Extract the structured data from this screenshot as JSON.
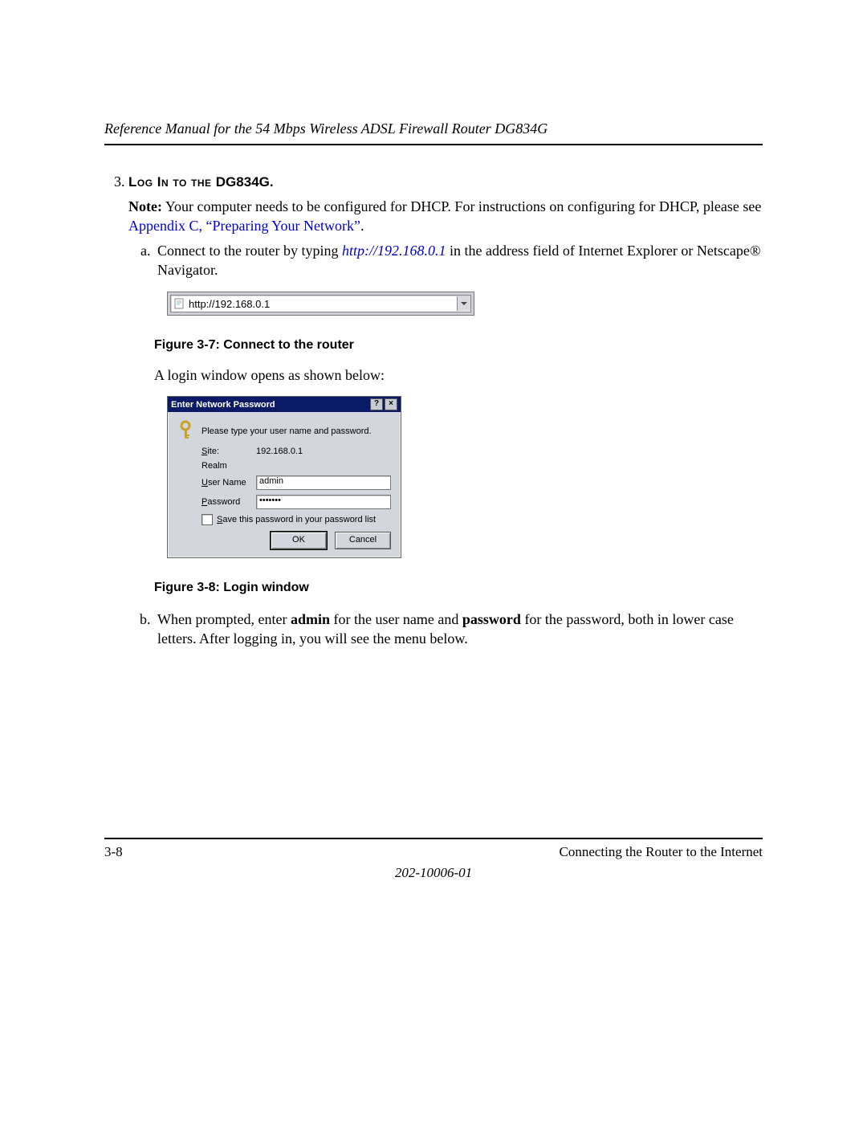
{
  "header": {
    "running_title": "Reference Manual for the 54 Mbps Wireless ADSL Firewall Router DG834G"
  },
  "step": {
    "number": "3.",
    "title_caps": "Log In to the ",
    "title_model": "DG834G",
    "title_period": ".",
    "note_label": "Note:",
    "note_text": " Your computer needs to be configured for DHCP. For instructions on configuring for DHCP, please see ",
    "note_link": "Appendix C, “Preparing Your Network”",
    "note_after": ".",
    "sub_a_pre": "Connect to the router by typing ",
    "sub_a_link": "http://192.168.0.1",
    "sub_a_post": " in the address field of Internet Explorer or Netscape",
    "sub_a_reg": "®",
    "sub_a_post2": " Navigator.",
    "addr_value": "http://192.168.0.1",
    "fig1_caption": "Figure 3-7:  Connect to the router",
    "login_intro": "A login window opens as shown below:",
    "dialog": {
      "title": "Enter Network Password",
      "help_btn": "?",
      "close_btn": "×",
      "prompt": "Please type your user name and password.",
      "site_label": "Site:",
      "site_value": "192.168.0.1",
      "realm_label": "Realm",
      "realm_value": "",
      "user_label_u": "U",
      "user_label_rest": "ser Name",
      "user_value": "admin",
      "pass_label_u": "P",
      "pass_label_rest": "assword",
      "pass_value": "•••••••",
      "save_u": "S",
      "save_rest": "ave this password in your password list",
      "ok": "OK",
      "cancel": "Cancel"
    },
    "fig2_caption": "Figure 3-8:  Login window",
    "sub_b_pre": "When prompted, enter ",
    "sub_b_b1": "admin",
    "sub_b_mid": " for the user name and ",
    "sub_b_b2": "password",
    "sub_b_post": " for the password, both in lower case letters. After logging in, you will see the menu below."
  },
  "footer": {
    "page": "3-8",
    "section": "Connecting the Router to the Internet",
    "docnum": "202-10006-01"
  }
}
